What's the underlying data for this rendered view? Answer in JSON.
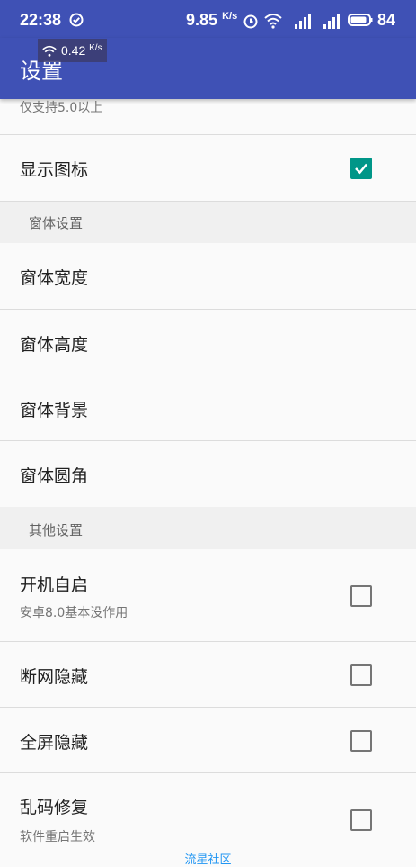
{
  "status_bar": {
    "time": "22:38",
    "speed": "9.85",
    "speed_unit": "K/s",
    "battery": "84"
  },
  "floating_speed": {
    "value": "0.42",
    "unit": "K/s"
  },
  "app_bar": {
    "title": "设置"
  },
  "partial_row": {
    "subtitle": "仅支持5.0以上"
  },
  "rows": {
    "show_icon": {
      "title": "显示图标",
      "checked": true
    },
    "section_window": "窗体设置",
    "window_width": {
      "title": "窗体宽度"
    },
    "window_height": {
      "title": "窗体高度"
    },
    "window_background": {
      "title": "窗体背景"
    },
    "window_corner": {
      "title": "窗体圆角"
    },
    "section_other": "其他设置",
    "autostart": {
      "title": "开机自启",
      "subtitle": "安卓8.0基本没作用",
      "checked": false
    },
    "hide_offline": {
      "title": "断网隐藏",
      "checked": false
    },
    "hide_fullscreen": {
      "title": "全屏隐藏",
      "checked": false
    },
    "fix_garbled": {
      "title": "乱码修复",
      "subtitle": "软件重启生效",
      "checked": false
    }
  },
  "footer": "流星社区",
  "colors": {
    "primary": "#3f51b5",
    "accent": "#009688"
  }
}
